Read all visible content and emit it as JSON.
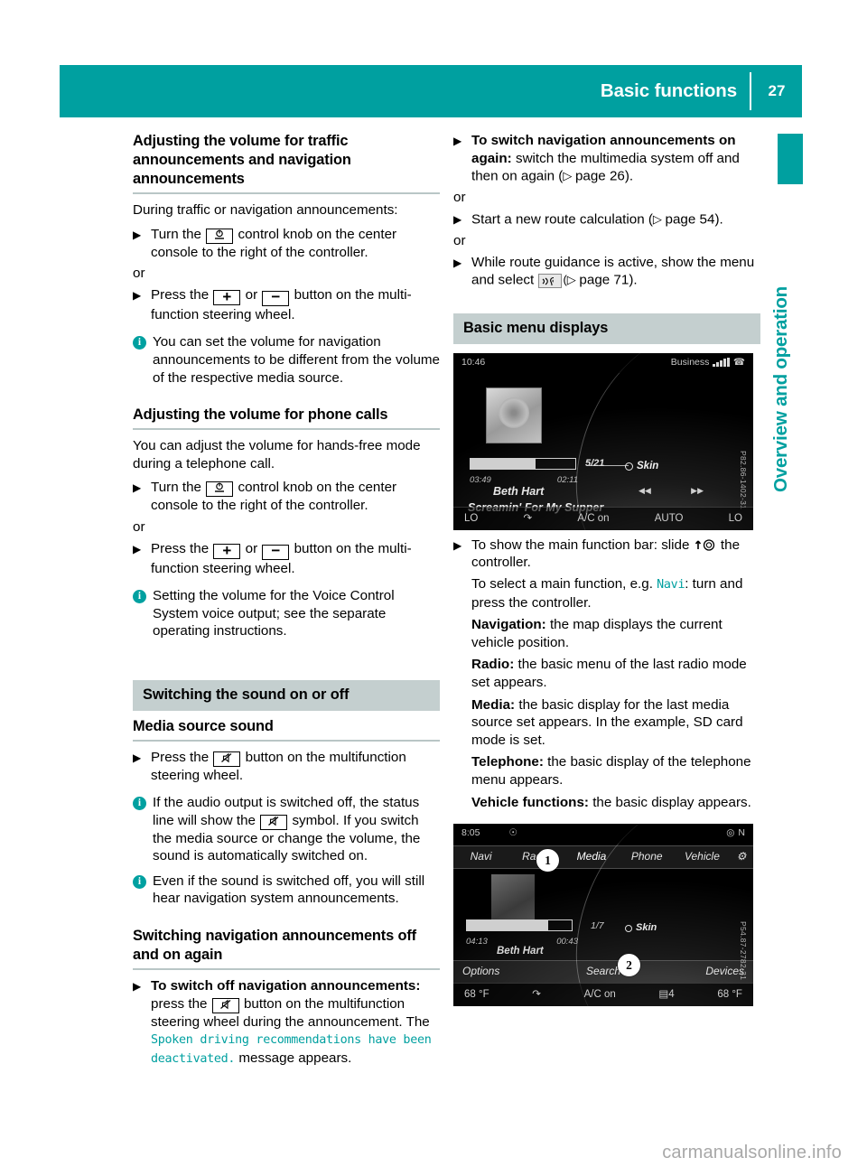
{
  "header": {
    "title": "Basic functions",
    "page_number": "27"
  },
  "side_tab": {
    "label": "Overview and operation"
  },
  "colors": {
    "teal": "#00a0a0",
    "grey_header": "#c4cfcf",
    "rule": "#b9c6c6"
  },
  "left_column": {
    "heading_1": "Adjusting the volume for traffic announcements and navigation announcements",
    "intro_1": "During traffic or navigation announcements:",
    "step_1_pre": "Turn the",
    "step_1_post": "control knob on the center console to the right of the controller.",
    "or_1": "or",
    "step_2_pre": "Press the",
    "step_2_mid": "or",
    "step_2_post": "button on the multi-function steering wheel.",
    "note_1": "You can set the volume for navigation announcements to be different from the volume of the respective media source.",
    "heading_2": "Adjusting the volume for phone calls",
    "intro_2": "You can adjust the volume for hands-free mode during a telephone call.",
    "step_3_pre": "Turn the",
    "step_3_post": "control knob on the center console to the right of the controller.",
    "or_2": "or",
    "step_4_pre": "Press the",
    "step_4_mid": "or",
    "step_4_post": "button on the multi-function steering wheel.",
    "note_2": "Setting the volume for the Voice Control System voice output; see the separate operating instructions.",
    "grey_header_1": "Switching the sound on or off",
    "heading_3": "Media source sound",
    "step_5_pre": "Press the",
    "step_5_post": "button on the multifunction steering wheel.",
    "note_3_a": "If the audio output is switched off, the status line will show the",
    "note_3_b": "symbol. If you switch the media source or change the volume, the sound is automatically switched on.",
    "note_4": "Even if the sound is switched off, you will still hear navigation system announcements.",
    "heading_4": "Switching navigation announcements off and on again",
    "step_6_bold": "To switch off navigation announcements:",
    "step_6_a": "press the",
    "step_6_b": "button on the multifunction steering wheel during the announcement. The",
    "step_6_msg": "Spoken driving recommendations have been deactivated.",
    "step_6_c": "message appears."
  },
  "right_column": {
    "step_1_bold": "To switch navigation announcements on again:",
    "step_1_text": "switch the multimedia system off and then on again (",
    "step_1_ref": "page 26",
    "step_1_tail": ").",
    "or_1": "or",
    "step_2_text": "Start a new route calculation (",
    "step_2_ref": "page 54",
    "step_2_tail": ").",
    "or_2": "or",
    "step_3_text": "While route guidance is active, show the menu and select",
    "step_3_ref": "page 71",
    "step_3_tail": ").",
    "grey_header_1": "Basic menu displays",
    "step_4_a": "To show the main function bar: slide",
    "step_4_b": "the controller.",
    "para_select_a": "To select a main function, e.g.",
    "para_select_msg": "Navi",
    "para_select_b": ": turn and press the controller.",
    "def_navigation_label": "Navigation:",
    "def_navigation_text": "the map displays the current vehicle position.",
    "def_radio_label": "Radio:",
    "def_radio_text": "the basic menu of the last radio mode set appears.",
    "def_media_label": "Media:",
    "def_media_text": "the basic display for the last media source set appears. In the example, SD card mode is set.",
    "def_telephone_label": "Telephone:",
    "def_telephone_text": "the basic display of the telephone menu appears.",
    "def_vehicle_label": "Vehicle functions:",
    "def_vehicle_text": "the basic display appears."
  },
  "screenshot_1": {
    "time": "10:46",
    "carrier": "Business",
    "track_number": "5/21",
    "skin_label": "Skin",
    "elapsed": "03:49",
    "remaining": "02:11",
    "artist": "Beth Hart",
    "album": "Screamin' For My Supper",
    "side_code": "P82.86-1402-31",
    "climate_left": "LO",
    "climate_center": "A/C on",
    "climate_auto": "AUTO",
    "climate_right": "LO"
  },
  "screenshot_2": {
    "time": "8:05",
    "func_bar": [
      "Navi",
      "Radio",
      "Media",
      "Phone",
      "Vehicle"
    ],
    "selected_function": "Media",
    "track_number": "1/7",
    "skin_label": "Skin",
    "elapsed": "04:13",
    "remaining": "00:43",
    "artist": "Beth Hart",
    "option_left": "Options",
    "option_center": "Search",
    "option_right": "Devices",
    "callout_1": "1",
    "callout_2": "2",
    "side_code": "P54.87-2782-31",
    "climate_left": "68 °F",
    "climate_center": "A/C on",
    "climate_right": "68 °F"
  },
  "watermark": "carmanualsonline.info"
}
